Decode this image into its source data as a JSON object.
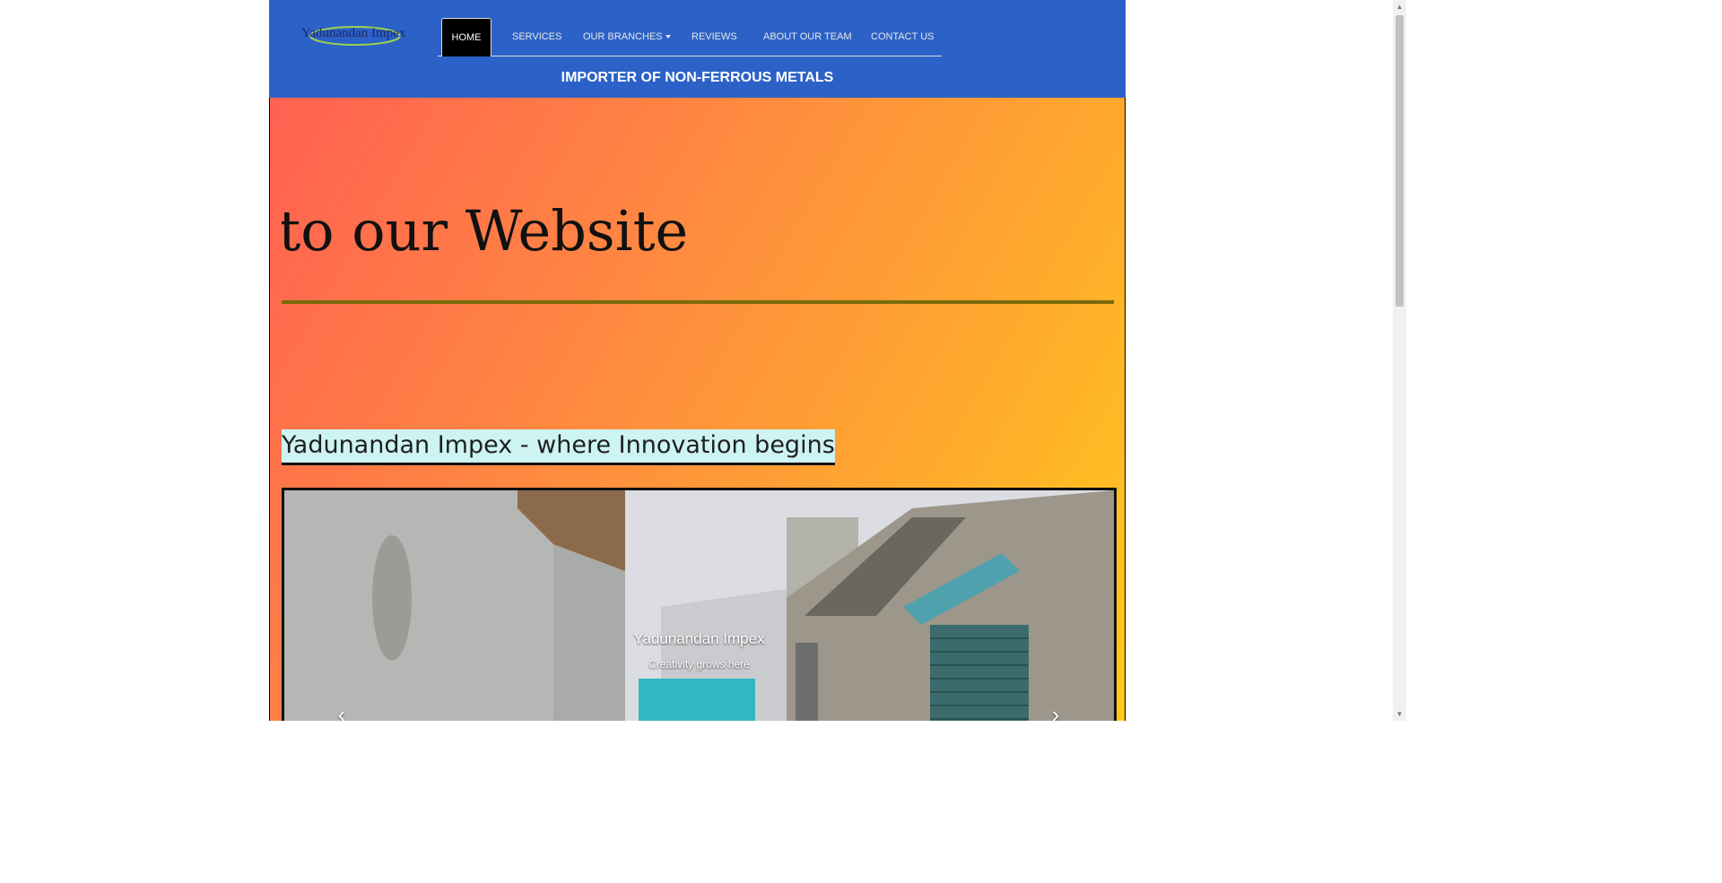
{
  "brand": {
    "logo_text": "Yadunandan Impex"
  },
  "nav": {
    "items": [
      {
        "label": "HOME",
        "active": true
      },
      {
        "label": "SERVICES"
      },
      {
        "label": "OUR BRANCHES",
        "dropdown": true
      },
      {
        "label": "REVIEWS"
      },
      {
        "label": "ABOUT OUR TEAM"
      },
      {
        "label": "CONTACT US"
      }
    ]
  },
  "header": {
    "tagline": "IMPORTER OF NON-FERROUS METALS"
  },
  "hero": {
    "marquee": "ne to our Website",
    "motto": "Yadunandan Impex - where Innovation begins"
  },
  "carousel": {
    "caption_title": "Yadunandan Impex",
    "caption_subtitle": "Creativity grows here",
    "prev_icon": "chevron-left-icon",
    "next_icon": "chevron-right-icon"
  },
  "colors": {
    "header_bg": "#2c62c7",
    "active_tab_bg": "#000000",
    "rule": "#7a6a0a",
    "motto_bg": "#cdf4f3",
    "gradient_start": "#ff6152",
    "gradient_end": "#ffca1c"
  }
}
